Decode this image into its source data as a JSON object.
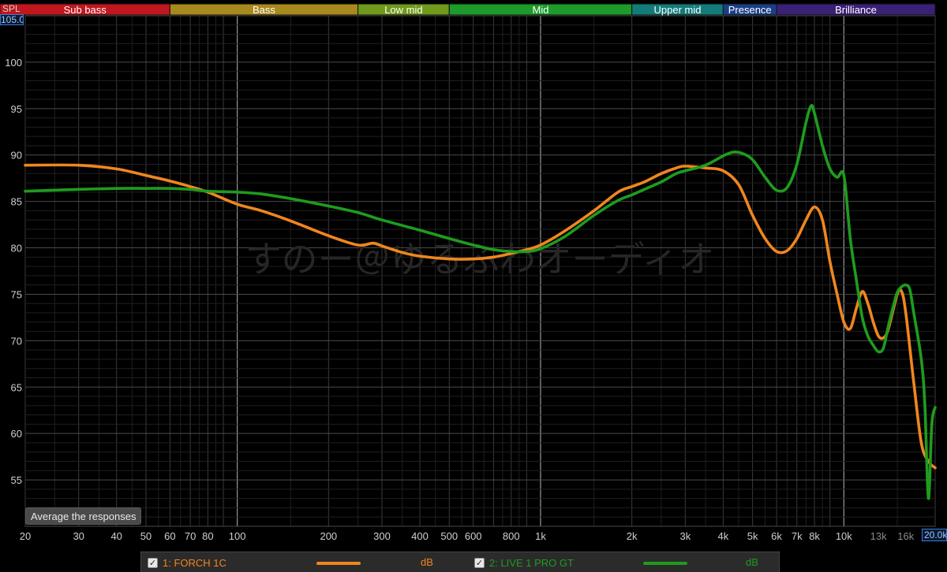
{
  "axis": {
    "y_unit_label": "SPL",
    "y_max_value": "105.00",
    "x_max_value": "20.0k"
  },
  "bands": [
    {
      "label": "Sub bass",
      "from": 20,
      "to": 60,
      "color": "#c0161e"
    },
    {
      "label": "Bass",
      "from": 60,
      "to": 250,
      "color": "#a8891c"
    },
    {
      "label": "Low mid",
      "from": 250,
      "to": 500,
      "color": "#6f9a1a"
    },
    {
      "label": "Mid",
      "from": 500,
      "to": 2000,
      "color": "#1c9a2a"
    },
    {
      "label": "Upper mid",
      "from": 2000,
      "to": 4000,
      "color": "#137c7a"
    },
    {
      "label": "Presence",
      "from": 4000,
      "to": 6000,
      "color": "#1b3f86"
    },
    {
      "label": "Brilliance",
      "from": 6000,
      "to": 20000,
      "color": "#3a2077"
    }
  ],
  "watermark": "すのー＠ゆるふわオーディオ",
  "average_button_label": "Average the responses",
  "legend": [
    {
      "label": "1: FORCH 1C",
      "unit": "dB",
      "color": "#f0861e",
      "checked": true
    },
    {
      "label": "2: LIVE 1 PRO GT",
      "unit": "dB",
      "color": "#1e9c1e",
      "checked": true
    }
  ],
  "chart_data": {
    "type": "line",
    "xscale": "log",
    "xlim": [
      20,
      20000
    ],
    "ylim": [
      50,
      105
    ],
    "yticks": [
      55,
      60,
      65,
      70,
      75,
      80,
      85,
      90,
      95,
      100
    ],
    "yticklabels": [
      "55",
      "60",
      "65",
      "70",
      "75",
      "80",
      "85",
      "90",
      "95",
      "100"
    ],
    "xticks": [
      20,
      30,
      40,
      50,
      60,
      70,
      80,
      100,
      200,
      300,
      400,
      500,
      600,
      800,
      1000,
      2000,
      3000,
      4000,
      5000,
      6000,
      7000,
      8000,
      10000,
      13000,
      16000
    ],
    "xticklabels": [
      "20",
      "30",
      "40",
      "50",
      "60",
      "70",
      "80",
      "100",
      "200",
      "300",
      "400",
      "500",
      "600",
      "800",
      "1k",
      "2k",
      "3k",
      "4k",
      "5k",
      "6k",
      "7k",
      "8k",
      "10k",
      "13k",
      "16k"
    ],
    "grid": true,
    "series": [
      {
        "name": "1: FORCH 1C",
        "x": [
          20,
          30,
          40,
          50,
          60,
          70,
          80,
          100,
          120,
          150,
          200,
          250,
          280,
          300,
          350,
          400,
          500,
          600,
          700,
          800,
          900,
          1000,
          1200,
          1500,
          1800,
          2000,
          2200,
          2500,
          2800,
          3000,
          3500,
          4000,
          4500,
          5000,
          5500,
          6000,
          6500,
          7000,
          7500,
          8000,
          8500,
          9000,
          9500,
          10000,
          10500,
          11000,
          11500,
          12000,
          12500,
          13000,
          13500,
          14000,
          15000,
          15500,
          16000,
          17000,
          18000,
          19000,
          20000
        ],
        "y": [
          88.9,
          88.9,
          88.5,
          87.8,
          87.2,
          86.6,
          86.0,
          84.7,
          84.0,
          82.9,
          81.3,
          80.3,
          80.5,
          80.2,
          79.5,
          79.1,
          78.8,
          78.8,
          79.0,
          79.4,
          79.8,
          80.3,
          81.8,
          84.0,
          86.0,
          86.6,
          87.1,
          88.0,
          88.6,
          88.8,
          88.6,
          88.3,
          86.8,
          83.5,
          81.0,
          79.6,
          79.7,
          81.0,
          83.0,
          84.4,
          83.0,
          78.5,
          75.0,
          72.0,
          71.3,
          73.5,
          75.3,
          74.0,
          72.0,
          70.5,
          70.3,
          71.2,
          75.0,
          75.3,
          73.0,
          65.5,
          59.0,
          57.0,
          56.3
        ]
      },
      {
        "name": "2: LIVE 1 PRO GT",
        "x": [
          20,
          30,
          40,
          50,
          60,
          70,
          80,
          100,
          120,
          150,
          200,
          250,
          300,
          400,
          500,
          600,
          700,
          800,
          900,
          1000,
          1200,
          1500,
          1800,
          2000,
          2200,
          2500,
          2800,
          3000,
          3500,
          4000,
          4300,
          4600,
          5000,
          5500,
          6000,
          6500,
          7000,
          7500,
          7800,
          8000,
          8500,
          9000,
          9500,
          10000,
          10500,
          11000,
          11500,
          12000,
          12500,
          13000,
          13500,
          14000,
          14500,
          15000,
          15500,
          16000,
          16500,
          17000,
          18000,
          18500,
          19000,
          19500,
          20000
        ],
        "y": [
          86.1,
          86.3,
          86.4,
          86.4,
          86.4,
          86.3,
          86.1,
          86.0,
          85.8,
          85.3,
          84.5,
          83.8,
          83.0,
          81.9,
          81.0,
          80.3,
          79.8,
          79.6,
          79.6,
          79.9,
          81.2,
          83.5,
          85.1,
          85.7,
          86.3,
          87.1,
          88.0,
          88.3,
          88.9,
          89.9,
          90.3,
          90.2,
          89.5,
          87.6,
          86.2,
          86.5,
          89.0,
          93.5,
          95.3,
          94.5,
          91.0,
          88.5,
          87.6,
          87.8,
          81.0,
          76.5,
          72.5,
          70.5,
          69.5,
          68.8,
          69.2,
          71.5,
          73.5,
          75.2,
          75.8,
          76.0,
          75.5,
          73.0,
          68.0,
          63.0,
          53.0,
          61.0,
          62.8
        ]
      }
    ]
  }
}
